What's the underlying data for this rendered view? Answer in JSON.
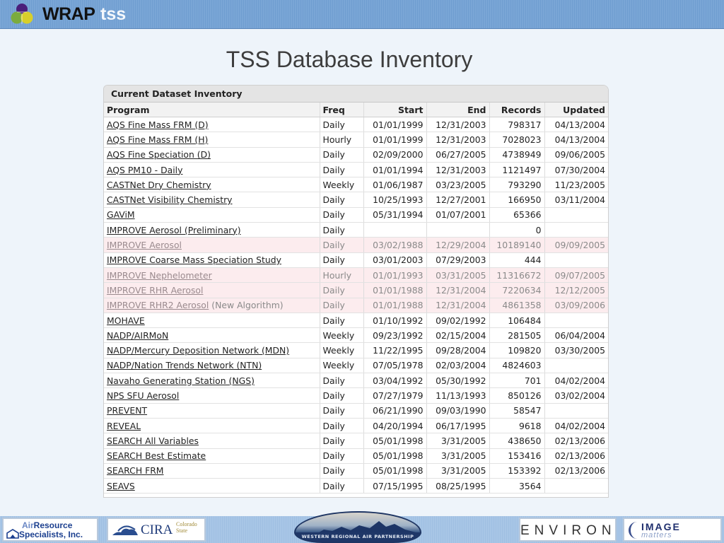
{
  "header": {
    "logo_text": "WRAP",
    "logo_suffix": "tss",
    "logo_icon": "wrap-tricolor-circles-icon",
    "brand_colors": {
      "purple": "#4a1e7a",
      "green": "#7bab3e",
      "yellow": "#d7cf2a",
      "band": "#7aa6d6"
    }
  },
  "page": {
    "title": "TSS Database Inventory"
  },
  "inventory": {
    "panel_title": "Current Dataset Inventory",
    "columns": [
      "Program",
      "Freq",
      "Start",
      "End",
      "Records",
      "Updated"
    ],
    "rows": [
      {
        "program": "AQS Fine Mass FRM (D)",
        "note": "",
        "freq": "Daily",
        "start": "01/01/1999",
        "end": "12/31/2003",
        "records": "798317",
        "updated": "04/13/2004",
        "dim": false
      },
      {
        "program": "AQS Fine Mass FRM (H)",
        "note": "",
        "freq": "Hourly",
        "start": "01/01/1999",
        "end": "12/31/2003",
        "records": "7028023",
        "updated": "04/13/2004",
        "dim": false
      },
      {
        "program": "AQS Fine Speciation (D)",
        "note": "",
        "freq": "Daily",
        "start": "02/09/2000",
        "end": "06/27/2005",
        "records": "4738949",
        "updated": "09/06/2005",
        "dim": false
      },
      {
        "program": "AQS PM10 - Daily",
        "note": "",
        "freq": "Daily",
        "start": "01/01/1994",
        "end": "12/31/2003",
        "records": "1121497",
        "updated": "07/30/2004",
        "dim": false
      },
      {
        "program": "CASTNet Dry Chemistry",
        "note": "",
        "freq": "Weekly",
        "start": "01/06/1987",
        "end": "03/23/2005",
        "records": "793290",
        "updated": "11/23/2005",
        "dim": false
      },
      {
        "program": "CASTNet Visibility Chemistry",
        "note": "",
        "freq": "Daily",
        "start": "10/25/1993",
        "end": "12/27/2001",
        "records": "166950",
        "updated": "03/11/2004",
        "dim": false
      },
      {
        "program": "GAViM",
        "note": "",
        "freq": "Daily",
        "start": "05/31/1994",
        "end": "01/07/2001",
        "records": "65366",
        "updated": "",
        "dim": false
      },
      {
        "program": "IMPROVE Aerosol (Preliminary)",
        "note": "",
        "freq": "Daily",
        "start": "",
        "end": "",
        "records": "0",
        "updated": "",
        "dim": false
      },
      {
        "program": "IMPROVE Aerosol",
        "note": "",
        "freq": "Daily",
        "start": "03/02/1988",
        "end": "12/29/2004",
        "records": "10189140",
        "updated": "09/09/2005",
        "dim": true
      },
      {
        "program": "IMPROVE Coarse Mass Speciation Study",
        "note": "",
        "freq": "Daily",
        "start": "03/01/2003",
        "end": "07/29/2003",
        "records": "444",
        "updated": "",
        "dim": false
      },
      {
        "program": "IMPROVE Nephelometer",
        "note": "",
        "freq": "Hourly",
        "start": "01/01/1993",
        "end": "03/31/2005",
        "records": "11316672",
        "updated": "09/07/2005",
        "dim": true
      },
      {
        "program": "IMPROVE RHR Aerosol",
        "note": "",
        "freq": "Daily",
        "start": "01/01/1988",
        "end": "12/31/2004",
        "records": "7220634",
        "updated": "12/12/2005",
        "dim": true
      },
      {
        "program": "IMPROVE RHR2 Aerosol",
        "note": "(New Algorithm)",
        "freq": "Daily",
        "start": "01/01/1988",
        "end": "12/31/2004",
        "records": "4861358",
        "updated": "03/09/2006",
        "dim": true
      },
      {
        "program": "MOHAVE",
        "note": "",
        "freq": "Daily",
        "start": "01/10/1992",
        "end": "09/02/1992",
        "records": "106484",
        "updated": "",
        "dim": false
      },
      {
        "program": "NADP/AIRMoN",
        "note": "",
        "freq": "Weekly",
        "start": "09/23/1992",
        "end": "02/15/2004",
        "records": "281505",
        "updated": "06/04/2004",
        "dim": false
      },
      {
        "program": "NADP/Mercury Deposition Network (MDN)",
        "note": "",
        "freq": "Weekly",
        "start": "11/22/1995",
        "end": "09/28/2004",
        "records": "109820",
        "updated": "03/30/2005",
        "dim": false
      },
      {
        "program": "NADP/Nation Trends Network (NTN)",
        "note": "",
        "freq": "Weekly",
        "start": "07/05/1978",
        "end": "02/03/2004",
        "records": "4824603",
        "updated": "",
        "dim": false
      },
      {
        "program": "Navaho Generating Station (NGS)",
        "note": "",
        "freq": "Daily",
        "start": "03/04/1992",
        "end": "05/30/1992",
        "records": "701",
        "updated": "04/02/2004",
        "dim": false
      },
      {
        "program": "NPS SFU Aerosol",
        "note": "",
        "freq": "Daily",
        "start": "07/27/1979",
        "end": "11/13/1993",
        "records": "850126",
        "updated": "03/02/2004",
        "dim": false
      },
      {
        "program": "PREVENT",
        "note": "",
        "freq": "Daily",
        "start": "06/21/1990",
        "end": "09/03/1990",
        "records": "58547",
        "updated": "",
        "dim": false
      },
      {
        "program": "REVEAL",
        "note": "",
        "freq": "Daily",
        "start": "04/20/1994",
        "end": "06/17/1995",
        "records": "9618",
        "updated": "04/02/2004",
        "dim": false
      },
      {
        "program": "SEARCH All Variables",
        "note": "",
        "freq": "Daily",
        "start": "05/01/1998",
        "end": "3/31/2005",
        "records": "438650",
        "updated": "02/13/2006",
        "dim": false
      },
      {
        "program": "SEARCH Best Estimate",
        "note": "",
        "freq": "Daily",
        "start": "05/01/1998",
        "end": "3/31/2005",
        "records": "153416",
        "updated": "02/13/2006",
        "dim": false
      },
      {
        "program": "SEARCH FRM",
        "note": "",
        "freq": "Daily",
        "start": "05/01/1998",
        "end": "3/31/2005",
        "records": "153392",
        "updated": "02/13/2006",
        "dim": false
      },
      {
        "program": "SEAVS",
        "note": "",
        "freq": "Daily",
        "start": "07/15/1995",
        "end": "08/25/1995",
        "records": "3564",
        "updated": "",
        "dim": false
      }
    ],
    "colors": {
      "dim_row_bg": "#fcecee",
      "dim_text": "#8a8a8a",
      "header_bg": "#e4e4e4"
    }
  },
  "footer": {
    "partners": [
      {
        "line1_prefix": "Air",
        "line1": "Resource",
        "line2": "Specialists, Inc."
      },
      {
        "name": "CIRA",
        "sub": "Colorado State"
      },
      {
        "band": "WESTERN REGIONAL AIR PARTNERSHIP"
      },
      {
        "name": "ENVIRON"
      },
      {
        "line1": "IMAGE",
        "line2": "matters"
      }
    ]
  }
}
